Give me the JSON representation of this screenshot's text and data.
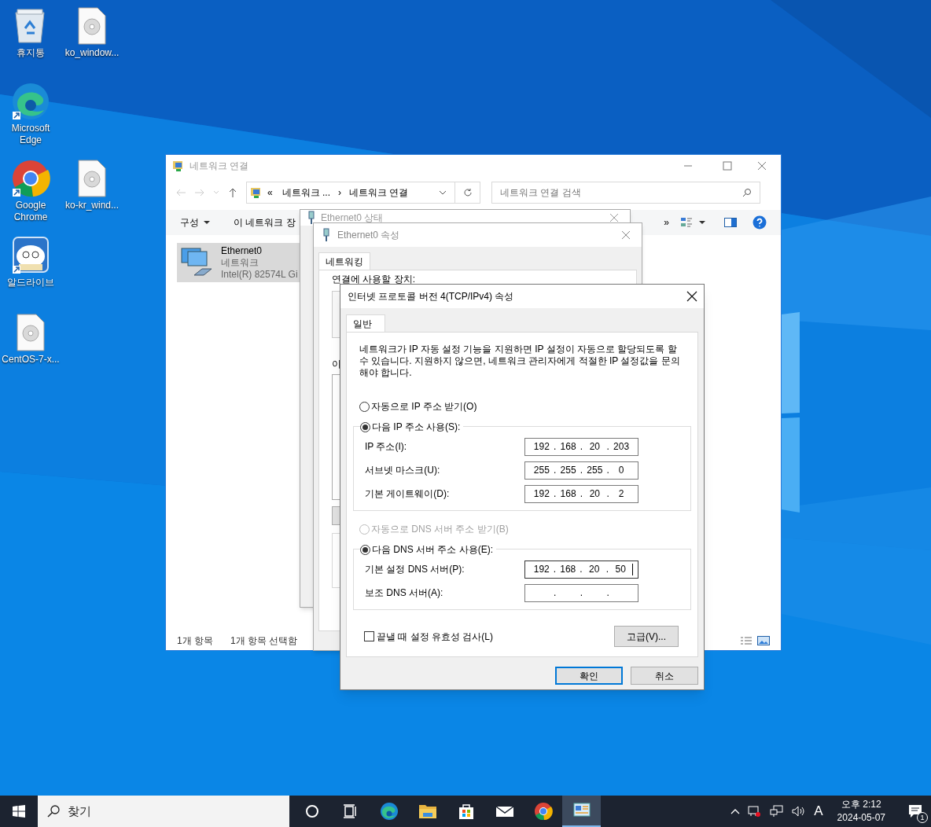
{
  "desktop_icons": [
    {
      "label": "휴지통",
      "kind": "recycle"
    },
    {
      "label": "ko_window...",
      "kind": "disc"
    },
    {
      "label": "Microsoft Edge",
      "kind": "edge"
    },
    {
      "label": "Google Chrome",
      "kind": "chrome"
    },
    {
      "label": "ko-kr_wind...",
      "kind": "disc"
    },
    {
      "label": "알드라이브",
      "kind": "aldrive"
    },
    {
      "label": "CentOS-7-x...",
      "kind": "disc"
    }
  ],
  "explorer": {
    "title": "네트워크 연결",
    "address": {
      "overflow": "«",
      "parent": "네트워크 ...",
      "separator": "›",
      "current": "네트워크 연결"
    },
    "search": {
      "placeholder": "네트워크 연결 검색"
    },
    "toolbar": {
      "organize": "구성",
      "action": "이 네트워크 장",
      "more": "»"
    },
    "items": [
      {
        "name": "Ethernet0",
        "network": "네트워크",
        "adapter": "Intel(R) 82574L Gi",
        "selected": true
      }
    ],
    "status": [
      "1개 항목",
      "1개 항목 선택함"
    ]
  },
  "status_dialog": {
    "title": "Ethernet0 상태"
  },
  "properties_dialog": {
    "title": "Ethernet0 속성",
    "tabs": [
      {
        "label": "네트워킹",
        "selected": true
      }
    ],
    "device_label": "연결에 사용할 장치:",
    "items_label": "이"
  },
  "tcp_dialog": {
    "title": "인터넷 프로토콜 버전 4(TCP/IPv4) 속성",
    "tabs": [
      {
        "label": "일반",
        "selected": true
      }
    ],
    "description": "네트워크가 IP 자동 설정 기능을 지원하면 IP 설정이 자동으로 할당되도록 할 수 있습니다. 지원하지 않으면, 네트워크 관리자에게 적절한 IP 설정값을 문의해야 합니다.",
    "octet_separator": ".",
    "ip_options": [
      {
        "label": "자동으로 IP 주소 받기(O)",
        "selected": false,
        "disabled": false
      },
      {
        "label": "다음 IP 주소 사용(S):",
        "selected": true,
        "disabled": false
      }
    ],
    "ip_fields": [
      {
        "label": "IP 주소(I):",
        "octets": [
          "192",
          "168",
          "20",
          "203"
        ]
      },
      {
        "label": "서브넷 마스크(U):",
        "octets": [
          "255",
          "255",
          "255",
          "0"
        ]
      },
      {
        "label": "기본 게이트웨이(D):",
        "octets": [
          "192",
          "168",
          "20",
          "2"
        ]
      }
    ],
    "dns_options": [
      {
        "label": "자동으로 DNS 서버 주소 받기(B)",
        "selected": false,
        "disabled": true
      },
      {
        "label": "다음 DNS 서버 주소 사용(E):",
        "selected": true,
        "disabled": false
      }
    ],
    "dns_fields": [
      {
        "label": "기본 설정 DNS 서버(P):",
        "octets": [
          "192",
          "168",
          "20",
          "50"
        ],
        "focused": true
      },
      {
        "label": "보조 DNS 서버(A):",
        "focused": false
      }
    ],
    "validate": {
      "label": "끝낼 때 설정 유효성 검사(L)",
      "checked": false
    },
    "advanced_button": "고급(V)...",
    "buttons": [
      {
        "label": "확인",
        "default": true
      },
      {
        "label": "취소",
        "default": false
      }
    ]
  },
  "taskbar": {
    "search_placeholder": "찾기",
    "apps": [
      {
        "kind": "cortana",
        "active": false
      },
      {
        "kind": "taskview",
        "active": false
      },
      {
        "kind": "edge",
        "active": false
      },
      {
        "kind": "folder",
        "active": false
      },
      {
        "kind": "store",
        "active": false
      },
      {
        "kind": "mail",
        "active": false
      },
      {
        "kind": "chrome",
        "active": false
      },
      {
        "kind": "control",
        "active": true
      }
    ],
    "ime": "A",
    "clock": {
      "time": "오후 2:12",
      "date": "2024-05-07"
    },
    "notifications": "1"
  }
}
